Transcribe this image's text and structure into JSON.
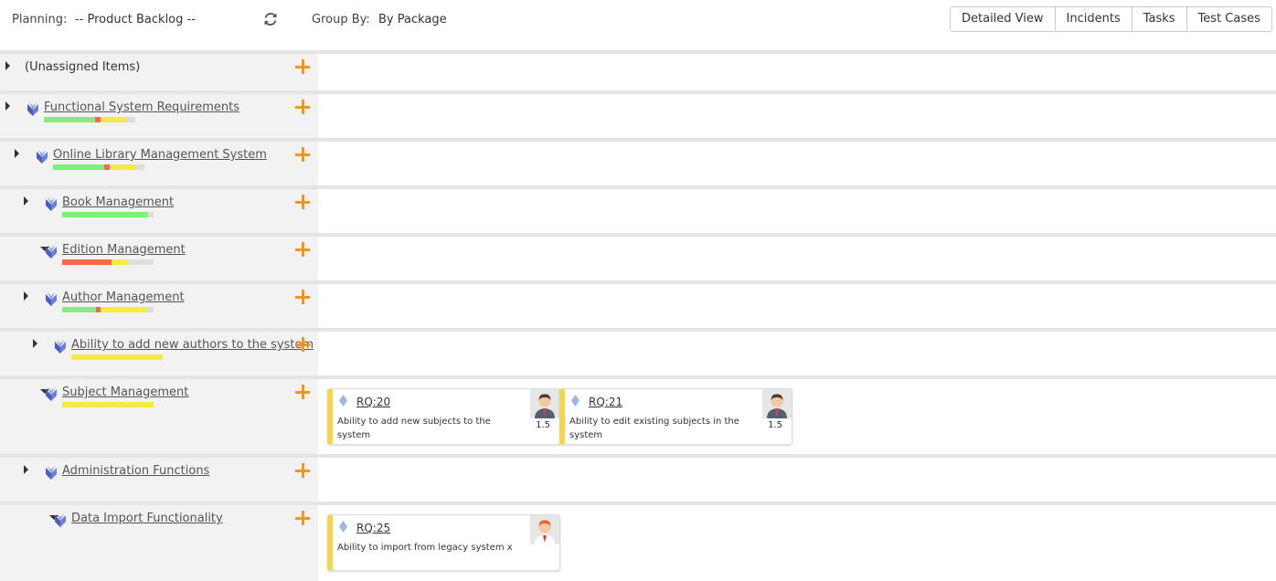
{
  "topbar": {
    "planning_label": "Planning:",
    "planning_value": "-- Product Backlog --",
    "groupby_label": "Group By:",
    "groupby_value": "By Package",
    "views": [
      "Detailed View",
      "Incidents",
      "Tasks",
      "Test Cases"
    ]
  },
  "colors": {
    "accent": "#f7941d",
    "green": "#7ef07a",
    "red": "#f36a4d",
    "yellow": "#f4ea45",
    "gray": "#dddddd",
    "card_border": "#f1d64e",
    "package_icon": "#6b7fd6"
  },
  "rows": [
    {
      "name": "(Unassigned Items)",
      "expanded": false,
      "linked": false
    },
    {
      "name": "Functional System Requirements",
      "expanded": false,
      "linked": true,
      "progress": {
        "green": 0.56,
        "red": 0.06,
        "yellow": 0.28
      }
    },
    {
      "name": "Online Library Management System",
      "expanded": false,
      "linked": true,
      "progress": {
        "green": 0.56,
        "red": 0.06,
        "yellow": 0.28
      }
    },
    {
      "name": "Book Management",
      "expanded": false,
      "linked": true,
      "progress": {
        "green": 0.94,
        "red": 0,
        "yellow": 0
      }
    },
    {
      "name": "Edition Management",
      "expanded": true,
      "linked": true,
      "progress": {
        "green": 0,
        "red": 0.54,
        "yellow": 0.17
      }
    },
    {
      "name": "Author Management",
      "expanded": false,
      "linked": true,
      "progress": {
        "green": 0.37,
        "red": 0.05,
        "yellow": 0.5
      }
    },
    {
      "name": "Ability to add new authors to the system",
      "expanded": false,
      "linked": true,
      "progress": {
        "green": 0,
        "red": 0,
        "yellow": 1.0
      }
    },
    {
      "name": "Subject Management",
      "expanded": true,
      "linked": true,
      "progress": {
        "green": 0,
        "red": 0,
        "yellow": 1.0
      }
    },
    {
      "name": "Administration Functions",
      "expanded": false,
      "linked": true
    },
    {
      "name": "Data Import Functionality",
      "expanded": true,
      "linked": true
    }
  ],
  "cards": [
    {
      "id": "RQ:20",
      "desc": "Ability to add new subjects to the system",
      "estimate": "1.5",
      "avatar": "man-avatar"
    },
    {
      "id": "RQ:21",
      "desc": "Ability to edit existing subjects in the system",
      "estimate": "1.5",
      "avatar": "man-avatar"
    },
    {
      "id": "RQ:25",
      "desc": "Ability to import from legacy system x",
      "estimate": "",
      "avatar": "man-red-hair-avatar"
    }
  ]
}
